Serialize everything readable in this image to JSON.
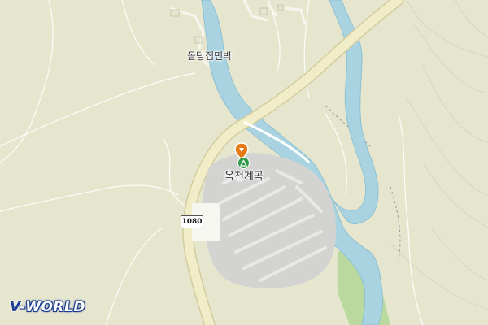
{
  "map": {
    "labels": {
      "lodging": "돌당집민박",
      "valley": "옥천계곡",
      "route_number": "1080"
    },
    "logo": {
      "prefix": "V",
      "text": "-WORLD"
    },
    "colors": {
      "land": "#e6e6cf",
      "river": "#a9d3e1",
      "river_edge": "#78b4c8",
      "road": "#f1edc8",
      "road_edge": "#d3cc9f",
      "parking": "#d3d3d1",
      "green_field": "#b9d99f",
      "brand": "#1a3d8f",
      "poi": "#e57a14"
    },
    "icons": [
      "location-pin-icon",
      "campsite-icon"
    ]
  }
}
